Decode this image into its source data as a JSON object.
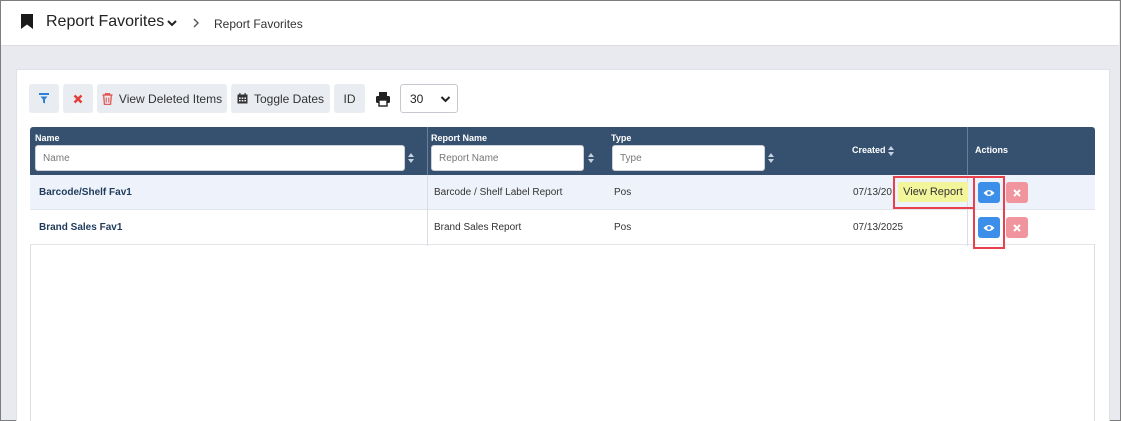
{
  "header": {
    "title": "Report Favorites",
    "breadcrumb": "Report Favorites"
  },
  "toolbar": {
    "view_deleted_label": "View Deleted Items",
    "toggle_dates_label": "Toggle Dates",
    "id_label": "ID",
    "page_size_value": "30"
  },
  "table": {
    "columns": {
      "name": {
        "label": "Name",
        "placeholder": "Name"
      },
      "report_name": {
        "label": "Report Name",
        "placeholder": "Report Name"
      },
      "type": {
        "label": "Type",
        "placeholder": "Type"
      },
      "created": {
        "label": "Created"
      },
      "actions": {
        "label": "Actions"
      }
    },
    "rows": [
      {
        "name": "Barcode/Shelf Fav1",
        "report_name": "Barcode / Shelf Label Report",
        "type": "Pos",
        "created": "07/13/20"
      },
      {
        "name": "Brand Sales Fav1",
        "report_name": "Brand Sales Report",
        "type": "Pos",
        "created": "07/13/2025"
      }
    ]
  },
  "tooltip": {
    "view_report": "View Report"
  },
  "colors": {
    "header_bg": "#35516f",
    "view_button": "#3c8fe8",
    "delete_button": "#f0949d",
    "highlight": "#e8414b",
    "tooltip_bg": "#f3f59b"
  },
  "icons": [
    "bookmark-icon",
    "chevron-down-icon",
    "chevron-right-icon",
    "filter-icon",
    "close-icon",
    "trash-icon",
    "calendar-icon",
    "print-icon",
    "sort-icon",
    "eye-icon"
  ]
}
